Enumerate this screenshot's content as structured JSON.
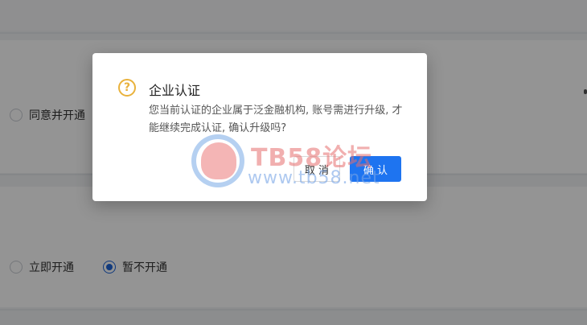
{
  "background": {
    "options": [
      {
        "label": "同意并开通",
        "checked": false
      },
      {
        "label": "立即开通",
        "checked": false
      },
      {
        "label": "暂不开通",
        "checked": true
      }
    ]
  },
  "dialog": {
    "icon": "question-circle-icon",
    "icon_glyph": "?",
    "title": "企业认证",
    "message": "您当前认证的企业属于泛金融机构, 账号需进行升级, 才能继续完成认证, 确认升级吗?",
    "cancel_label": "取 消",
    "confirm_label": "确 认"
  },
  "watermark": {
    "line1": "TB58论坛",
    "line2": "www.tb58.net"
  },
  "colors": {
    "primary": "#1e74f0",
    "warning": "#e9b23c",
    "overlay": "rgba(0,0,0,0.42)"
  }
}
